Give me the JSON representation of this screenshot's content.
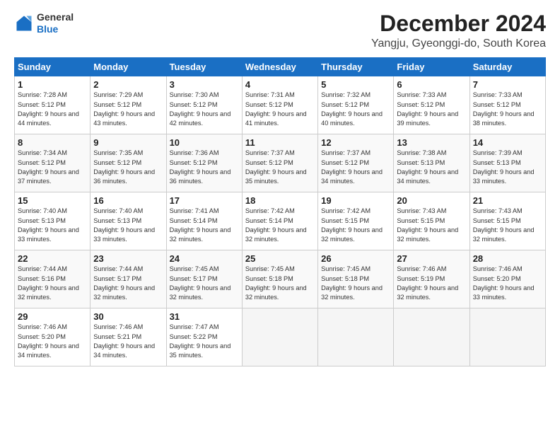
{
  "logo": {
    "general": "General",
    "blue": "Blue"
  },
  "header": {
    "month": "December 2024",
    "location": "Yangju, Gyeonggi-do, South Korea"
  },
  "weekdays": [
    "Sunday",
    "Monday",
    "Tuesday",
    "Wednesday",
    "Thursday",
    "Friday",
    "Saturday"
  ],
  "weeks": [
    [
      {
        "day": 1,
        "sunrise": "7:28 AM",
        "sunset": "5:12 PM",
        "daylight": "9 hours and 44 minutes."
      },
      {
        "day": 2,
        "sunrise": "7:29 AM",
        "sunset": "5:12 PM",
        "daylight": "9 hours and 43 minutes."
      },
      {
        "day": 3,
        "sunrise": "7:30 AM",
        "sunset": "5:12 PM",
        "daylight": "9 hours and 42 minutes."
      },
      {
        "day": 4,
        "sunrise": "7:31 AM",
        "sunset": "5:12 PM",
        "daylight": "9 hours and 41 minutes."
      },
      {
        "day": 5,
        "sunrise": "7:32 AM",
        "sunset": "5:12 PM",
        "daylight": "9 hours and 40 minutes."
      },
      {
        "day": 6,
        "sunrise": "7:33 AM",
        "sunset": "5:12 PM",
        "daylight": "9 hours and 39 minutes."
      },
      {
        "day": 7,
        "sunrise": "7:33 AM",
        "sunset": "5:12 PM",
        "daylight": "9 hours and 38 minutes."
      }
    ],
    [
      {
        "day": 8,
        "sunrise": "7:34 AM",
        "sunset": "5:12 PM",
        "daylight": "9 hours and 37 minutes."
      },
      {
        "day": 9,
        "sunrise": "7:35 AM",
        "sunset": "5:12 PM",
        "daylight": "9 hours and 36 minutes."
      },
      {
        "day": 10,
        "sunrise": "7:36 AM",
        "sunset": "5:12 PM",
        "daylight": "9 hours and 36 minutes."
      },
      {
        "day": 11,
        "sunrise": "7:37 AM",
        "sunset": "5:12 PM",
        "daylight": "9 hours and 35 minutes."
      },
      {
        "day": 12,
        "sunrise": "7:37 AM",
        "sunset": "5:12 PM",
        "daylight": "9 hours and 34 minutes."
      },
      {
        "day": 13,
        "sunrise": "7:38 AM",
        "sunset": "5:13 PM",
        "daylight": "9 hours and 34 minutes."
      },
      {
        "day": 14,
        "sunrise": "7:39 AM",
        "sunset": "5:13 PM",
        "daylight": "9 hours and 33 minutes."
      }
    ],
    [
      {
        "day": 15,
        "sunrise": "7:40 AM",
        "sunset": "5:13 PM",
        "daylight": "9 hours and 33 minutes."
      },
      {
        "day": 16,
        "sunrise": "7:40 AM",
        "sunset": "5:13 PM",
        "daylight": "9 hours and 33 minutes."
      },
      {
        "day": 17,
        "sunrise": "7:41 AM",
        "sunset": "5:14 PM",
        "daylight": "9 hours and 32 minutes."
      },
      {
        "day": 18,
        "sunrise": "7:42 AM",
        "sunset": "5:14 PM",
        "daylight": "9 hours and 32 minutes."
      },
      {
        "day": 19,
        "sunrise": "7:42 AM",
        "sunset": "5:15 PM",
        "daylight": "9 hours and 32 minutes."
      },
      {
        "day": 20,
        "sunrise": "7:43 AM",
        "sunset": "5:15 PM",
        "daylight": "9 hours and 32 minutes."
      },
      {
        "day": 21,
        "sunrise": "7:43 AM",
        "sunset": "5:15 PM",
        "daylight": "9 hours and 32 minutes."
      }
    ],
    [
      {
        "day": 22,
        "sunrise": "7:44 AM",
        "sunset": "5:16 PM",
        "daylight": "9 hours and 32 minutes."
      },
      {
        "day": 23,
        "sunrise": "7:44 AM",
        "sunset": "5:17 PM",
        "daylight": "9 hours and 32 minutes."
      },
      {
        "day": 24,
        "sunrise": "7:45 AM",
        "sunset": "5:17 PM",
        "daylight": "9 hours and 32 minutes."
      },
      {
        "day": 25,
        "sunrise": "7:45 AM",
        "sunset": "5:18 PM",
        "daylight": "9 hours and 32 minutes."
      },
      {
        "day": 26,
        "sunrise": "7:45 AM",
        "sunset": "5:18 PM",
        "daylight": "9 hours and 32 minutes."
      },
      {
        "day": 27,
        "sunrise": "7:46 AM",
        "sunset": "5:19 PM",
        "daylight": "9 hours and 32 minutes."
      },
      {
        "day": 28,
        "sunrise": "7:46 AM",
        "sunset": "5:20 PM",
        "daylight": "9 hours and 33 minutes."
      }
    ],
    [
      {
        "day": 29,
        "sunrise": "7:46 AM",
        "sunset": "5:20 PM",
        "daylight": "9 hours and 34 minutes."
      },
      {
        "day": 30,
        "sunrise": "7:46 AM",
        "sunset": "5:21 PM",
        "daylight": "9 hours and 34 minutes."
      },
      {
        "day": 31,
        "sunrise": "7:47 AM",
        "sunset": "5:22 PM",
        "daylight": "9 hours and 35 minutes."
      },
      null,
      null,
      null,
      null
    ]
  ]
}
